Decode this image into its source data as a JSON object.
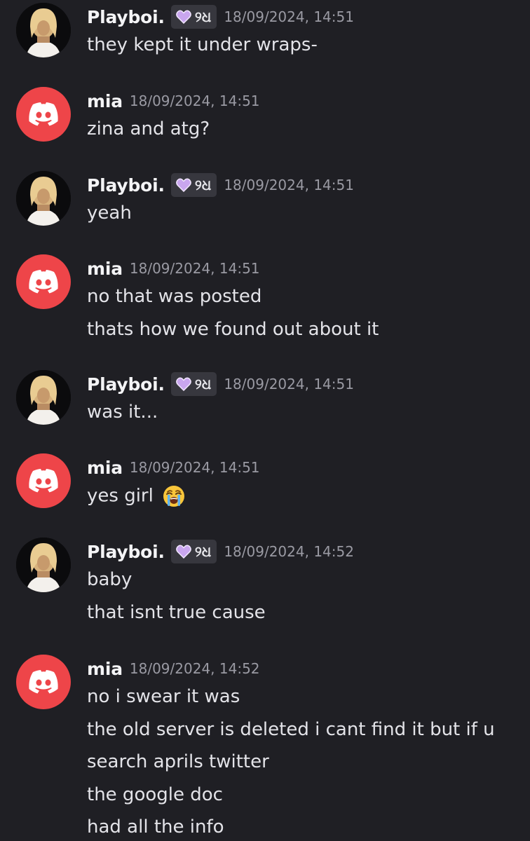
{
  "badge_tag": "୨ଧ",
  "colors": {
    "background": "#1f1f24",
    "discord_red": "#ee4549",
    "heart_purple": "#c9a6ef",
    "timestamp": "#9a9aa3"
  },
  "messages": [
    {
      "author": "Playboi.",
      "has_badge": true,
      "avatar_icon": "profile-photo",
      "timestamp": "18/09/2024, 14:51",
      "lines": [
        "they kept it under wraps-"
      ]
    },
    {
      "author": "mia",
      "has_badge": false,
      "avatar_icon": "discord-logo-icon",
      "timestamp": "18/09/2024, 14:51",
      "lines": [
        "zina and atg?"
      ]
    },
    {
      "author": "Playboi.",
      "has_badge": true,
      "avatar_icon": "profile-photo",
      "timestamp": "18/09/2024, 14:51",
      "lines": [
        "yeah"
      ]
    },
    {
      "author": "mia",
      "has_badge": false,
      "avatar_icon": "discord-logo-icon",
      "timestamp": "18/09/2024, 14:51",
      "lines": [
        "no that was posted",
        "thats how we found out about it"
      ]
    },
    {
      "author": "Playboi.",
      "has_badge": true,
      "avatar_icon": "profile-photo",
      "timestamp": "18/09/2024, 14:51",
      "lines": [
        "was it..."
      ]
    },
    {
      "author": "mia",
      "has_badge": false,
      "avatar_icon": "discord-logo-icon",
      "timestamp": "18/09/2024, 14:51",
      "lines": [
        "yes girl"
      ],
      "emoji": "loudly-crying-face-icon"
    },
    {
      "author": "Playboi.",
      "has_badge": true,
      "avatar_icon": "profile-photo",
      "timestamp": "18/09/2024, 14:52",
      "lines": [
        "baby",
        "that isnt true cause"
      ]
    },
    {
      "author": "mia",
      "has_badge": false,
      "avatar_icon": "discord-logo-icon",
      "timestamp": "18/09/2024, 14:52",
      "lines": [
        "no i swear it was",
        "the old server is deleted i cant find it but if u",
        "search aprils twitter",
        "the google doc",
        "had all the info"
      ]
    }
  ]
}
